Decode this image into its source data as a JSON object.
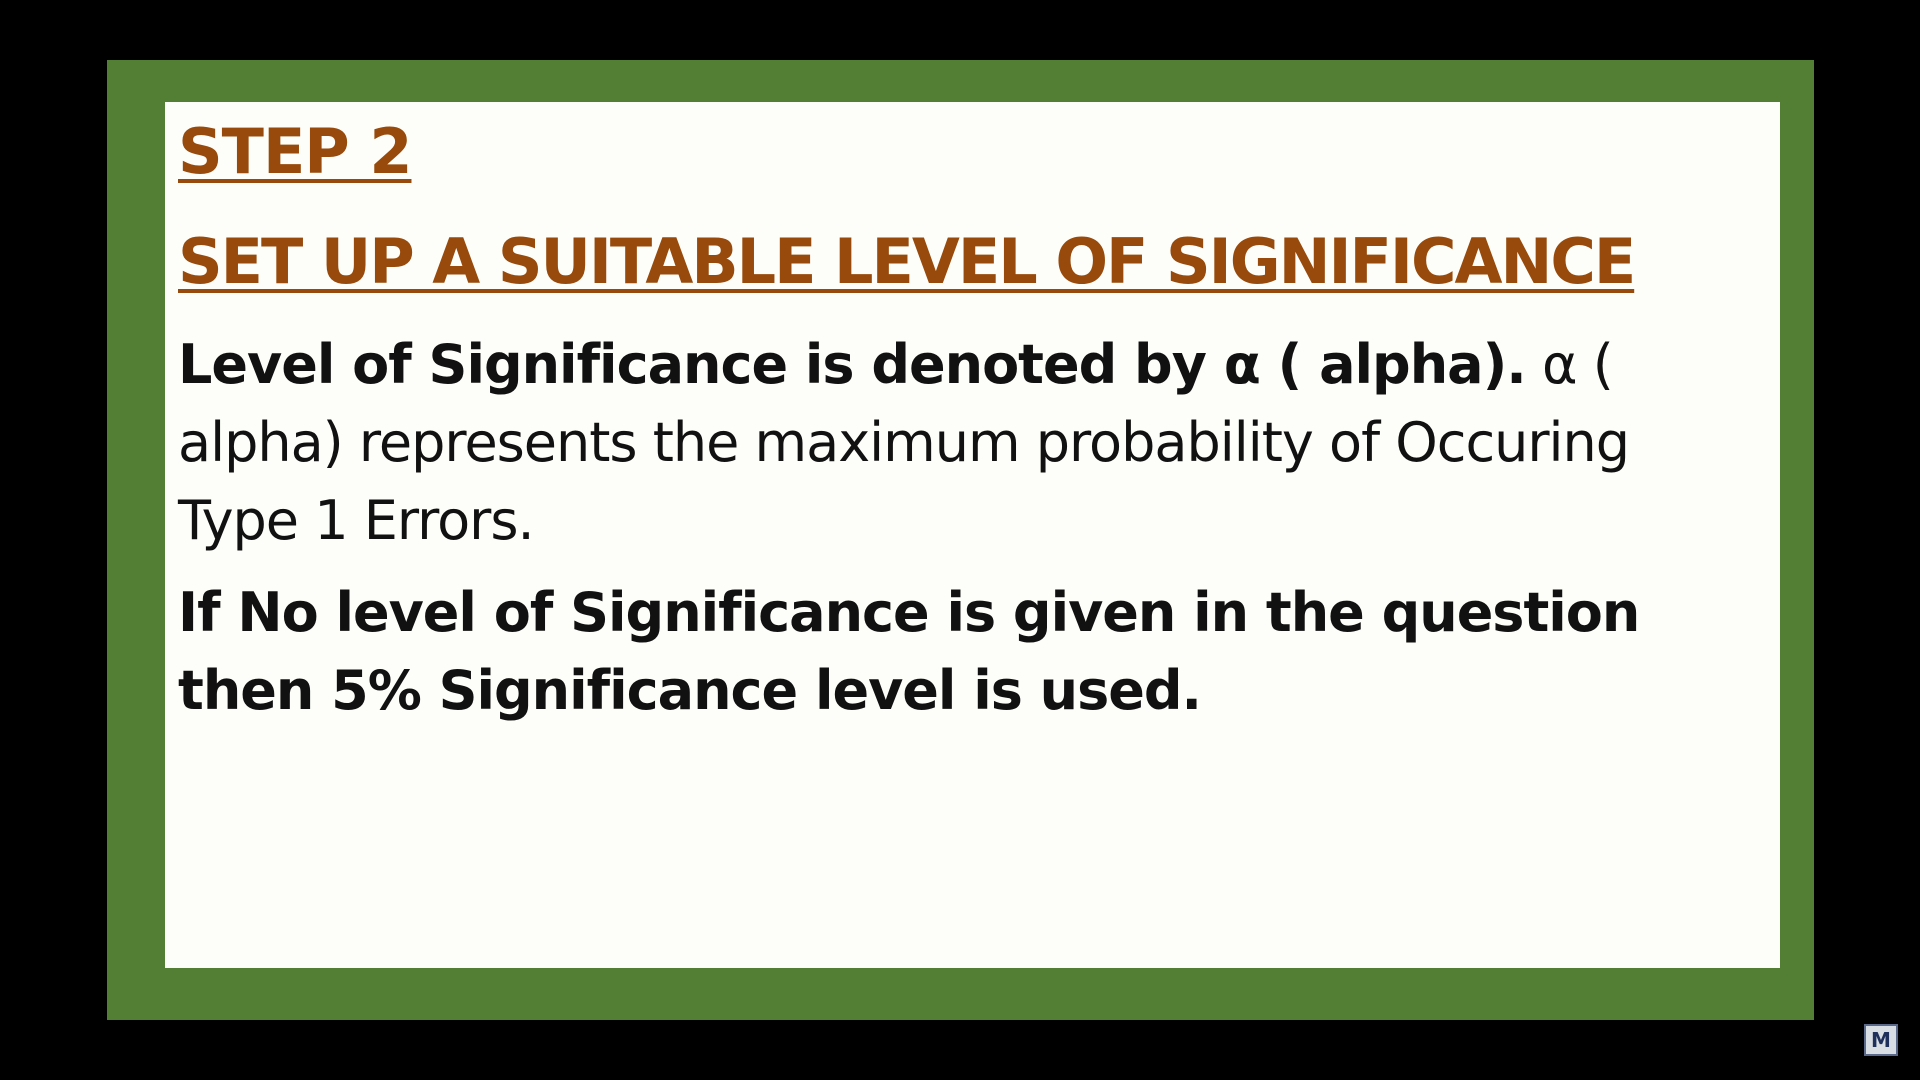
{
  "slide": {
    "step_title": "STEP 2",
    "section_title": "SET UP A SUITABLE LEVEL OF SIGNIFICANCE",
    "paragraph1": {
      "bold_part": "Level of Significance is denoted by α ( alpha).",
      "normal_part": " α ( alpha) represents the maximum probability of Occuring Type 1 Errors."
    },
    "paragraph2": "If No level of Significance is given in the question then 5% Significance level is used."
  },
  "watermark": {
    "logo_text": "M"
  },
  "colors": {
    "background": "#000000",
    "frame_green": "#527f34",
    "slide_bg": "#fdfef9",
    "heading_brown": "#974a0b",
    "text": "#111111"
  }
}
